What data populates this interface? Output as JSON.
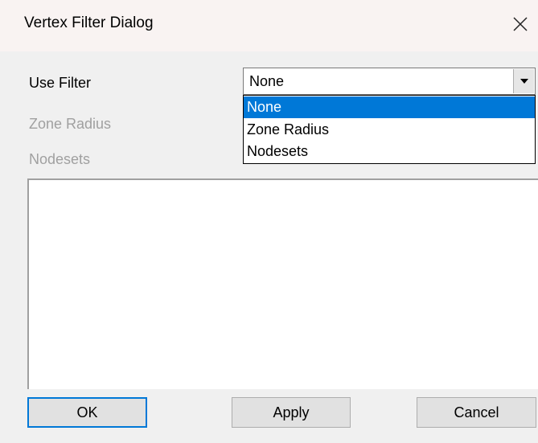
{
  "window": {
    "title": "Vertex Filter Dialog"
  },
  "form": {
    "use_filter_label": "Use Filter",
    "zone_radius_label": "Zone Radius",
    "nodesets_label": "Nodesets",
    "filter_select": {
      "value": "None",
      "options": [
        "None",
        "Zone Radius",
        "Nodesets"
      ],
      "highlighted": "None"
    }
  },
  "buttons": {
    "ok": "OK",
    "apply": "Apply",
    "cancel": "Cancel"
  },
  "colors": {
    "highlight": "#0078d7",
    "disabled_text": "#a0a0a0",
    "dialog_bg": "#f0f0f0",
    "titlebar_bg": "#f9f3f2"
  },
  "icons": {
    "close": "close-icon",
    "dropdown": "chevron-down-icon"
  }
}
